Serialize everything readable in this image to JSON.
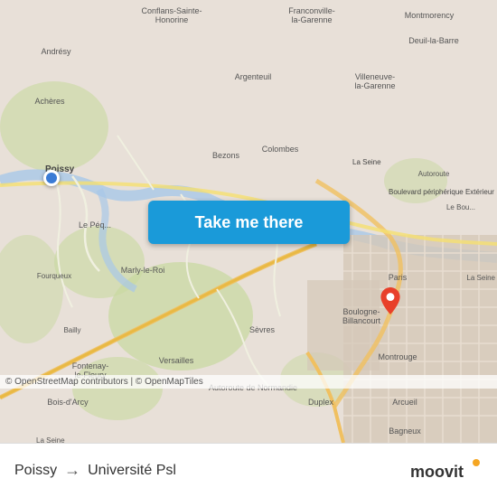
{
  "map": {
    "background_color": "#e8e0d8",
    "copyright": "© OpenStreetMap contributors | © OpenMapTiles"
  },
  "button": {
    "label": "Take me there"
  },
  "route": {
    "from": "Poissy",
    "to": "Université Psl",
    "arrow": "→"
  },
  "branding": {
    "logo_text": "moovit"
  },
  "icons": {
    "destination_pin_color": "#e8402a",
    "origin_dot_color": "#3a7bd5"
  }
}
